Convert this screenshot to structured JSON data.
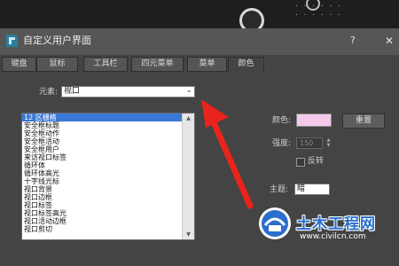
{
  "dialog": {
    "title": "自定义用户界面",
    "help_label": "?",
    "close_label": "✕"
  },
  "tabs": [
    {
      "label": "键盘",
      "active": false
    },
    {
      "label": "鼠标",
      "active": false
    },
    {
      "label": "工具栏",
      "active": false
    },
    {
      "label": "四元菜单",
      "active": false
    },
    {
      "label": "菜单",
      "active": false
    },
    {
      "label": "颜色",
      "active": true
    }
  ],
  "colors_tab": {
    "element_label": "元素:",
    "element_value": "视口",
    "items": [
      "12 区栅格",
      "安全框标题",
      "安全框动作",
      "安全框活动",
      "安全框用户",
      "来访视口标签",
      "循环体",
      "循环体高光",
      "十字线光标",
      "视口背景",
      "视口边框",
      "视口标签",
      "视口标签高光",
      "视口活动边框",
      "视口剪切"
    ],
    "selected_index": 0,
    "color_label": "颜色:",
    "color_value": "#f5c9ec",
    "reset_label": "重置",
    "intensity_label": "强度:",
    "intensity_value": "150",
    "invert_label": "反转",
    "theme_label": "主题:",
    "theme_value": "暗"
  },
  "watermark": {
    "title": "土木工程网",
    "url": "www.civilcn.com"
  },
  "accent_colors": {
    "selection": "#3a78d8",
    "arrow": "#e8241c",
    "watermark": "#2a6fcc"
  },
  "icons": [
    "app-icon",
    "help-icon",
    "close-icon",
    "dropdown-arrow-icon",
    "scroll-up-icon",
    "scroll-down-icon",
    "red-arrow-annotation",
    "watermark-logo"
  ]
}
